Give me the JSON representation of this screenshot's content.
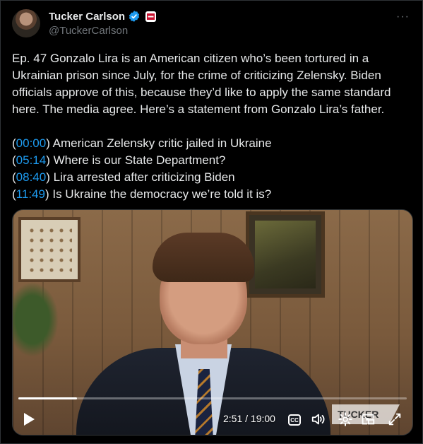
{
  "author": {
    "name": "Tucker Carlson",
    "handle": "@TuckerCarlson",
    "verified_icon": "verified-badge-icon",
    "affiliation_icon": "affiliation-badge-icon"
  },
  "tweet": {
    "text": "Ep. 47  Gonzalo Lira is an American citizen who’s been tortured in a Ukrainian prison since July, for the crime of criticizing Zelensky. Biden officials approve of this, because they’d like to apply the same standard here. The media agree. Here’s a statement from Gonzalo Lira’s father.",
    "chapters": [
      {
        "time": "00:00",
        "title": "American Zelensky critic jailed in Ukraine"
      },
      {
        "time": "05:14",
        "title": "Where is our State Department?"
      },
      {
        "time": "08:40",
        "title": "Lira arrested after criticizing Biden"
      },
      {
        "time": "11:49",
        "title": "Is Ukraine the democracy we’re told it is?"
      }
    ]
  },
  "video": {
    "time_display": "2:51 / 19:00",
    "progress_fraction": 0.15,
    "cc_label": "CC",
    "watermark_text": "TUCKER"
  },
  "colors": {
    "background": "#000000",
    "text": "#e7e9ea",
    "secondary": "#71767b",
    "link": "#1d9bf0",
    "verified": "#1d9bf0"
  }
}
